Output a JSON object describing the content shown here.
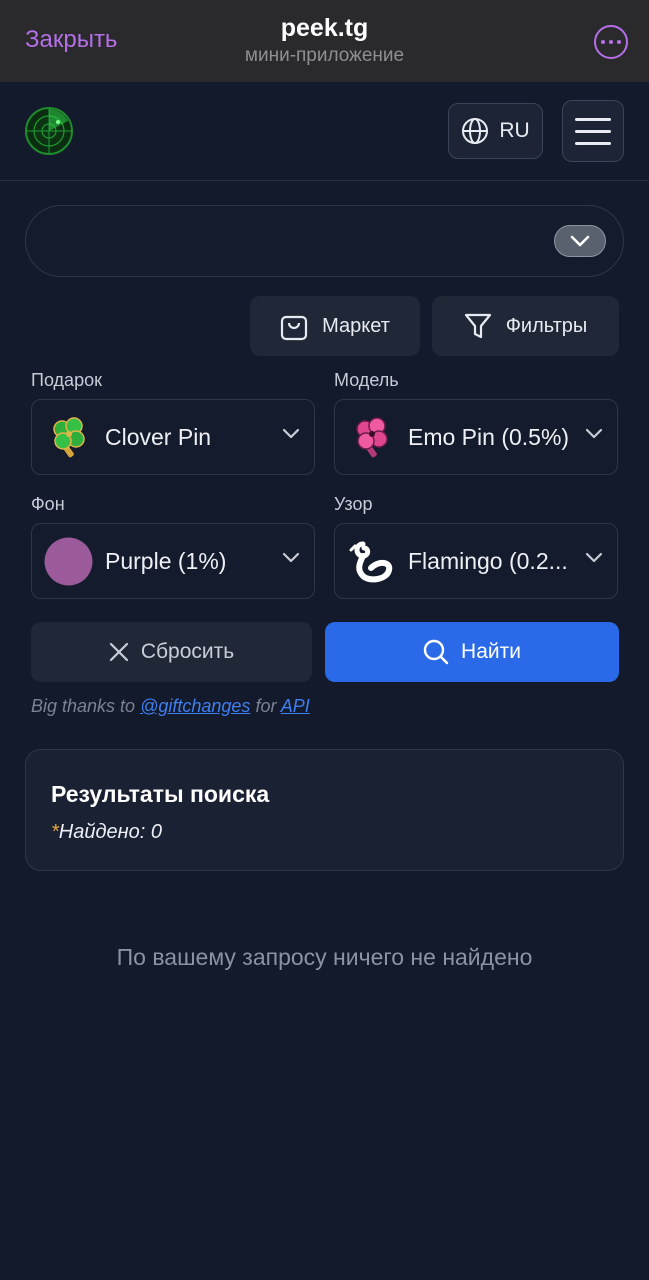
{
  "topbar": {
    "close_label": "Закрыть",
    "title": "peek.tg",
    "subtitle": "мини-приложение",
    "accent": "#b56fe6"
  },
  "header": {
    "logo_icon": "radar-icon",
    "language": "RU"
  },
  "toolbar": {
    "market_label": "Маркет",
    "filters_label": "Фильтры"
  },
  "filters": {
    "gift": {
      "label": "Подарок",
      "value": "Clover Pin",
      "icon": "clover-pin-icon"
    },
    "model": {
      "label": "Модель",
      "value": "Emo Pin (0.5%)",
      "icon": "emo-pin-icon"
    },
    "background": {
      "label": "Фон",
      "value": "Purple (1%)",
      "swatch": "#9b5a99"
    },
    "pattern": {
      "label": "Узор",
      "value": "Flamingo (0.2...",
      "icon": "flamingo-icon"
    }
  },
  "actions": {
    "reset_label": "Сбросить",
    "find_label": "Найти",
    "primary_color": "#2a6ae8"
  },
  "credits": {
    "prefix": "Big thanks to",
    "handle": "@giftchanges",
    "middle": "for",
    "api": "API"
  },
  "results": {
    "title": "Результаты поиска",
    "star": "*",
    "found_label": "Найдено: 0",
    "empty_message": "По вашему запросу ничего не найдено"
  }
}
